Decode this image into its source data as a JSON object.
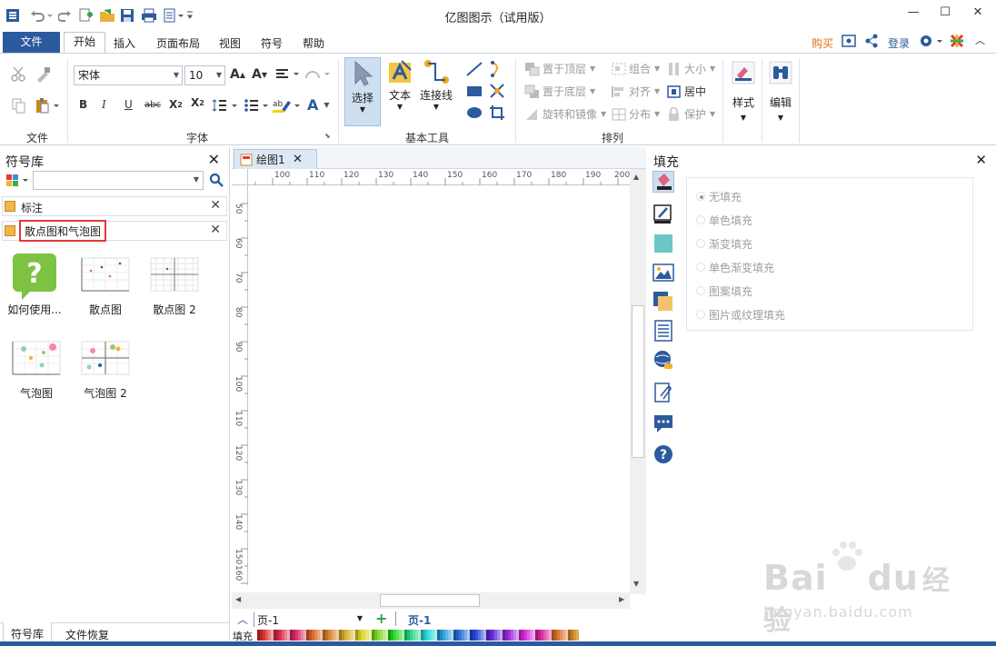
{
  "app": {
    "title": "亿图图示（试用版）"
  },
  "window": {
    "minimize": "—",
    "maximize": "☐",
    "close": "✕"
  },
  "menu": {
    "file": "文件",
    "tabs": [
      "开始",
      "插入",
      "页面布局",
      "视图",
      "符号",
      "帮助"
    ],
    "buy": "购买",
    "login": "登录"
  },
  "ribbon": {
    "groups": {
      "file": "文件",
      "font": "字体",
      "basic": "基本工具",
      "arrange": "排列"
    },
    "font_name": "宋体",
    "font_size": "10",
    "tools": {
      "select": "选择",
      "text": "文本",
      "connector": "连接线"
    },
    "arrange": {
      "bring_front": "置于顶层",
      "send_back": "置于底层",
      "rotate": "旋转和镜像",
      "group": "组合",
      "align": "对齐",
      "distribute": "分布",
      "size": "大小",
      "center": "居中",
      "protect": "保护"
    },
    "style": "样式",
    "edit": "编辑"
  },
  "left_panel": {
    "title": "符号库",
    "libraries": [
      "标注",
      "散点图和气泡图"
    ],
    "symbols": [
      "如何使用...",
      "散点图",
      "散点图 2",
      "气泡图",
      "气泡图 2"
    ],
    "bottom_tabs": [
      "符号库",
      "文件恢复"
    ]
  },
  "canvas": {
    "doc_tab": "绘图1",
    "ruler_h": [
      "100",
      "110",
      "120",
      "130",
      "140",
      "150",
      "160",
      "170",
      "180",
      "190",
      "200"
    ],
    "ruler_v": [
      "50",
      "60",
      "70",
      "80",
      "90",
      "100",
      "110",
      "120",
      "130",
      "140",
      "150",
      "160"
    ],
    "page_select": "页-1",
    "page_tab": "页-1",
    "fill_label": "填充"
  },
  "right_panel": {
    "title": "填充",
    "options": [
      "无填充",
      "单色填充",
      "渐变填充",
      "单色渐变填充",
      "图案填充",
      "图片或纹理填充"
    ],
    "selected": 0
  },
  "watermark": {
    "brand": "Bai",
    "brand2": "du",
    "brand3": "经验",
    "url": "jingyan.baidu.com"
  },
  "colors": {
    "accent": "#2c5a9e",
    "highlight": "#e53935"
  }
}
